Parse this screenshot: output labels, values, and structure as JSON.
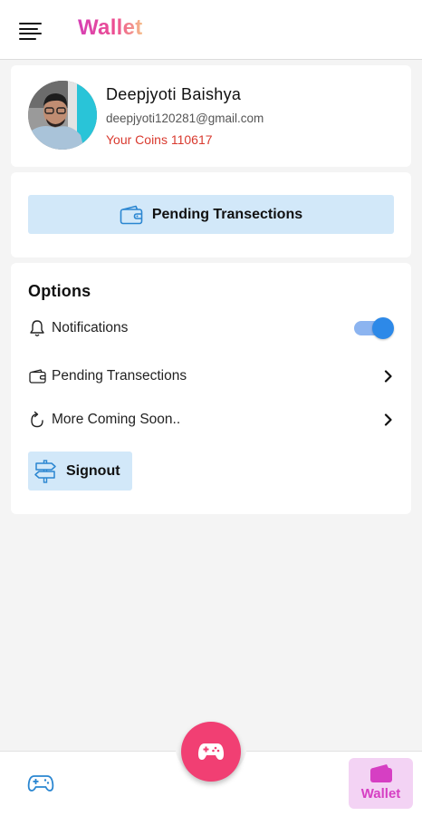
{
  "header": {
    "title": "Wallet",
    "menu_icon": "hamburger-menu-icon"
  },
  "profile": {
    "name": "Deepjyoti Baishya",
    "email": "deepjyoti120281@gmail.com",
    "coins_text": "Your Coins 110617",
    "coins_color": "#d93a2f"
  },
  "pending_button": {
    "label": "Pending Transections",
    "icon": "wallet-icon",
    "bg_color": "#d2e8f9"
  },
  "options": {
    "title": "Options",
    "items": [
      {
        "label": "Notifications",
        "icon": "bell-icon",
        "control": "toggle",
        "toggle_on": true
      },
      {
        "label": "Pending Transections",
        "icon": "wallet-icon",
        "control": "chevron-right-icon"
      },
      {
        "label": "More Coming Soon..",
        "icon": "refresh-icon",
        "control": "chevron-right-icon"
      }
    ],
    "signout_label": "Signout",
    "signout_icon": "signpost-icon"
  },
  "bottom_nav": {
    "fab_icon": "gamepad-icon",
    "fab_color": "#f13f73",
    "games_icon": "gamepad-outline-icon",
    "wallet_label": "Wallet",
    "wallet_icon": "wallet-icon",
    "active_color": "#d63fc3"
  }
}
